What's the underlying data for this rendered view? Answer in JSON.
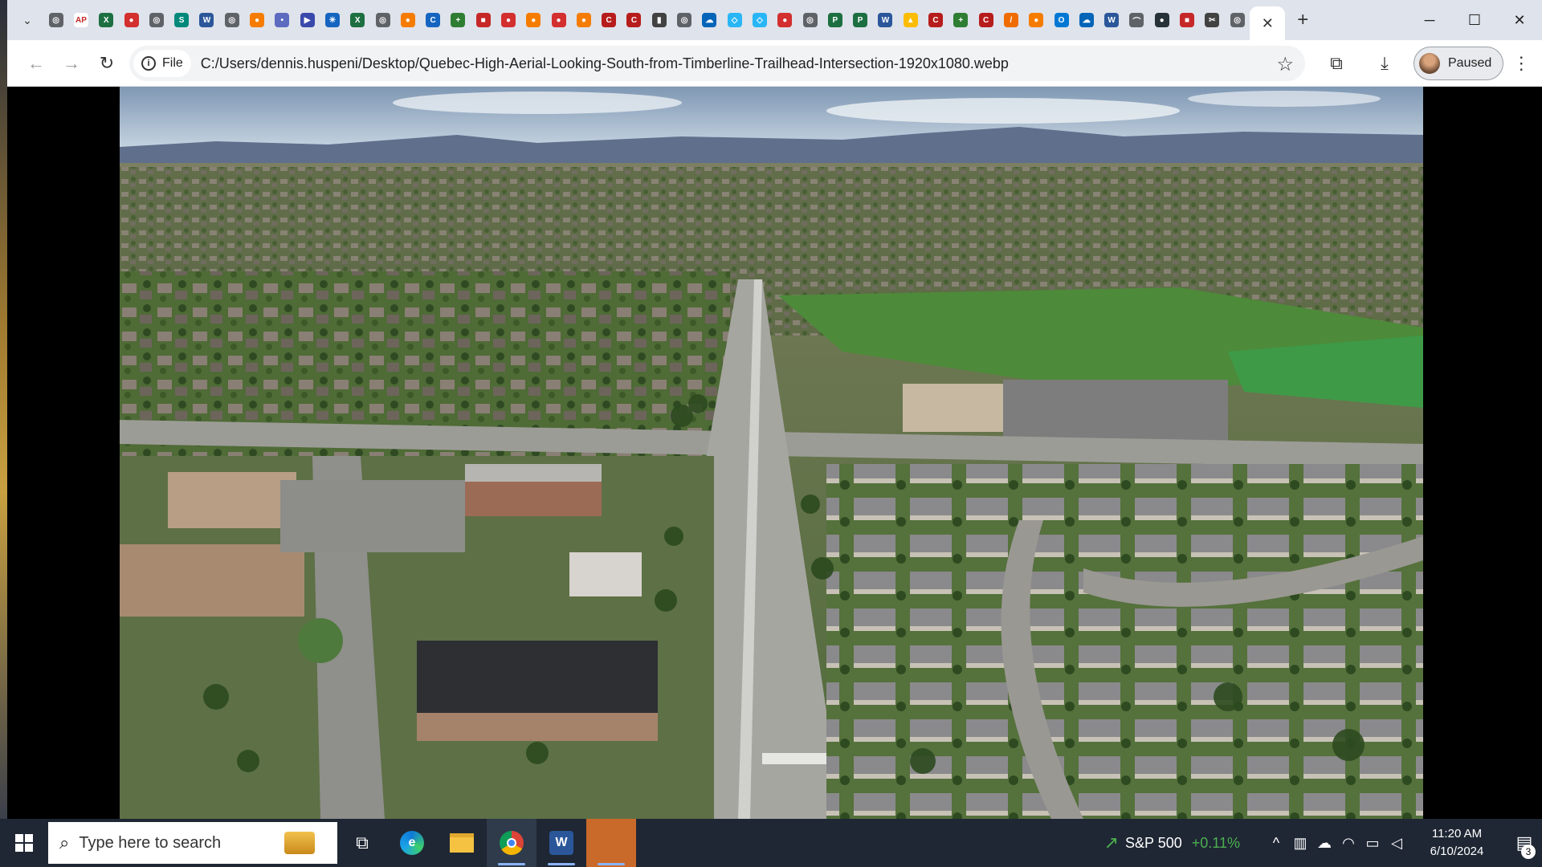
{
  "browser": {
    "tabs": {
      "favicons": [
        {
          "icon": "chrome-icon",
          "color": "#5f6368",
          "glyph": "◎"
        },
        {
          "icon": "ap-icon",
          "color": "#ffffff",
          "glyph": "AP"
        },
        {
          "icon": "excel-icon",
          "color": "#1d6f42",
          "glyph": "X"
        },
        {
          "icon": "red-circle-icon",
          "color": "#d32f2f",
          "glyph": "●"
        },
        {
          "icon": "globe-icon",
          "color": "#5f6368",
          "glyph": "◎"
        },
        {
          "icon": "teal-icon",
          "color": "#00897b",
          "glyph": "S"
        },
        {
          "icon": "word-icon",
          "color": "#2b579a",
          "glyph": "W"
        },
        {
          "icon": "globe-icon",
          "color": "#5f6368",
          "glyph": "◎"
        },
        {
          "icon": "orange-circle-icon",
          "color": "#f57c00",
          "glyph": "●"
        },
        {
          "icon": "teams-icon",
          "color": "#5c6bc0",
          "glyph": "•"
        },
        {
          "icon": "flag-icon",
          "color": "#3949ab",
          "glyph": "▶"
        },
        {
          "icon": "snowflake-icon",
          "color": "#1565c0",
          "glyph": "✳"
        },
        {
          "icon": "excel-icon",
          "color": "#1d6f42",
          "glyph": "X"
        },
        {
          "icon": "globe-icon",
          "color": "#5f6368",
          "glyph": "◎"
        },
        {
          "icon": "orange-circle-icon",
          "color": "#f57c00",
          "glyph": "●"
        },
        {
          "icon": "blue-square-icon",
          "color": "#1565c0",
          "glyph": "C"
        },
        {
          "icon": "green-plus-icon",
          "color": "#2e7d32",
          "glyph": "+"
        },
        {
          "icon": "red-bar-icon",
          "color": "#c62828",
          "glyph": "■"
        },
        {
          "icon": "red-circle-icon",
          "color": "#d32f2f",
          "glyph": "●"
        },
        {
          "icon": "orange-circle-icon",
          "color": "#f57c00",
          "glyph": "●"
        },
        {
          "icon": "red-circle-icon",
          "color": "#d32f2f",
          "glyph": "●"
        },
        {
          "icon": "orange-circle-icon",
          "color": "#f57c00",
          "glyph": "●"
        },
        {
          "icon": "colorado-icon",
          "color": "#b71c1c",
          "glyph": "C"
        },
        {
          "icon": "colorado-icon",
          "color": "#b71c1c",
          "glyph": "C"
        },
        {
          "icon": "document-icon",
          "color": "#424242",
          "glyph": "▮"
        },
        {
          "icon": "globe-icon",
          "color": "#5f6368",
          "glyph": "◎"
        },
        {
          "icon": "onedrive-icon",
          "color": "#0364b8",
          "glyph": "☁"
        },
        {
          "icon": "cube-icon",
          "color": "#29b6f6",
          "glyph": "◇"
        },
        {
          "icon": "cube-icon",
          "color": "#29b6f6",
          "glyph": "◇"
        },
        {
          "icon": "red-circle-icon",
          "color": "#d32f2f",
          "glyph": "●"
        },
        {
          "icon": "globe-icon",
          "color": "#5f6368",
          "glyph": "◎"
        },
        {
          "icon": "planner-icon",
          "color": "#1d6f42",
          "glyph": "P"
        },
        {
          "icon": "planner-icon",
          "color": "#1d6f42",
          "glyph": "P"
        },
        {
          "icon": "word-icon",
          "color": "#2b579a",
          "glyph": "W"
        },
        {
          "icon": "drive-icon",
          "color": "#fbbc04",
          "glyph": "▲"
        },
        {
          "icon": "colorado-icon",
          "color": "#b71c1c",
          "glyph": "C"
        },
        {
          "icon": "green-plus-icon",
          "color": "#2e7d32",
          "glyph": "+"
        },
        {
          "icon": "colorado-icon",
          "color": "#b71c1c",
          "glyph": "C"
        },
        {
          "icon": "pen-icon",
          "color": "#ef6c00",
          "glyph": "/"
        },
        {
          "icon": "orange-circle-icon",
          "color": "#f57c00",
          "glyph": "●"
        },
        {
          "icon": "outlook-icon",
          "color": "#0078d4",
          "glyph": "O"
        },
        {
          "icon": "onedrive-icon",
          "color": "#0364b8",
          "glyph": "☁"
        },
        {
          "icon": "word-icon",
          "color": "#2b579a",
          "glyph": "W"
        },
        {
          "icon": "wifi-icon",
          "color": "#5f6368",
          "glyph": "⌒"
        },
        {
          "icon": "dark-circle-icon",
          "color": "#263238",
          "glyph": "●"
        },
        {
          "icon": "red-bar-icon",
          "color": "#c62828",
          "glyph": "■"
        },
        {
          "icon": "scissors-icon",
          "color": "#424242",
          "glyph": "✂"
        },
        {
          "icon": "globe-icon",
          "color": "#5f6368",
          "glyph": "◎"
        }
      ],
      "active_close": "✕",
      "new_tab": "+"
    },
    "window_controls": {
      "minimize": "─",
      "maximize": "☐",
      "close": "✕"
    },
    "toolbar": {
      "back": "←",
      "forward": "→",
      "reload": "↻",
      "scheme_chip": "File",
      "url": "C:/Users/dennis.huspeni/Desktop/Quebec-High-Aerial-Looking-South-from-Timberline-Trailhead-Intersection-1920x1080.webp",
      "bookmark": "☆",
      "extensions": "⧉",
      "download": "⤓",
      "profile_label": "Paused",
      "menu": "⋮"
    }
  },
  "taskbar": {
    "search_placeholder": "Type here to search",
    "apps": [
      {
        "name": "task-view",
        "glyph": "⧉"
      },
      {
        "name": "edge",
        "glyph": "e"
      },
      {
        "name": "file-explorer",
        "glyph": "▬"
      },
      {
        "name": "chrome",
        "glyph": "◉"
      },
      {
        "name": "word",
        "glyph": "W"
      },
      {
        "name": "orange-app",
        "glyph": ""
      }
    ],
    "ticker": {
      "label": "S&P 500",
      "change": "+0.11%"
    },
    "clock": {
      "time": "11:20 AM",
      "date": "6/10/2024"
    },
    "notification_count": "3",
    "colors": {
      "accent": "#8ab4f8",
      "ticker_up": "#4caf50",
      "taskbar_bg": "#1f2734"
    }
  }
}
